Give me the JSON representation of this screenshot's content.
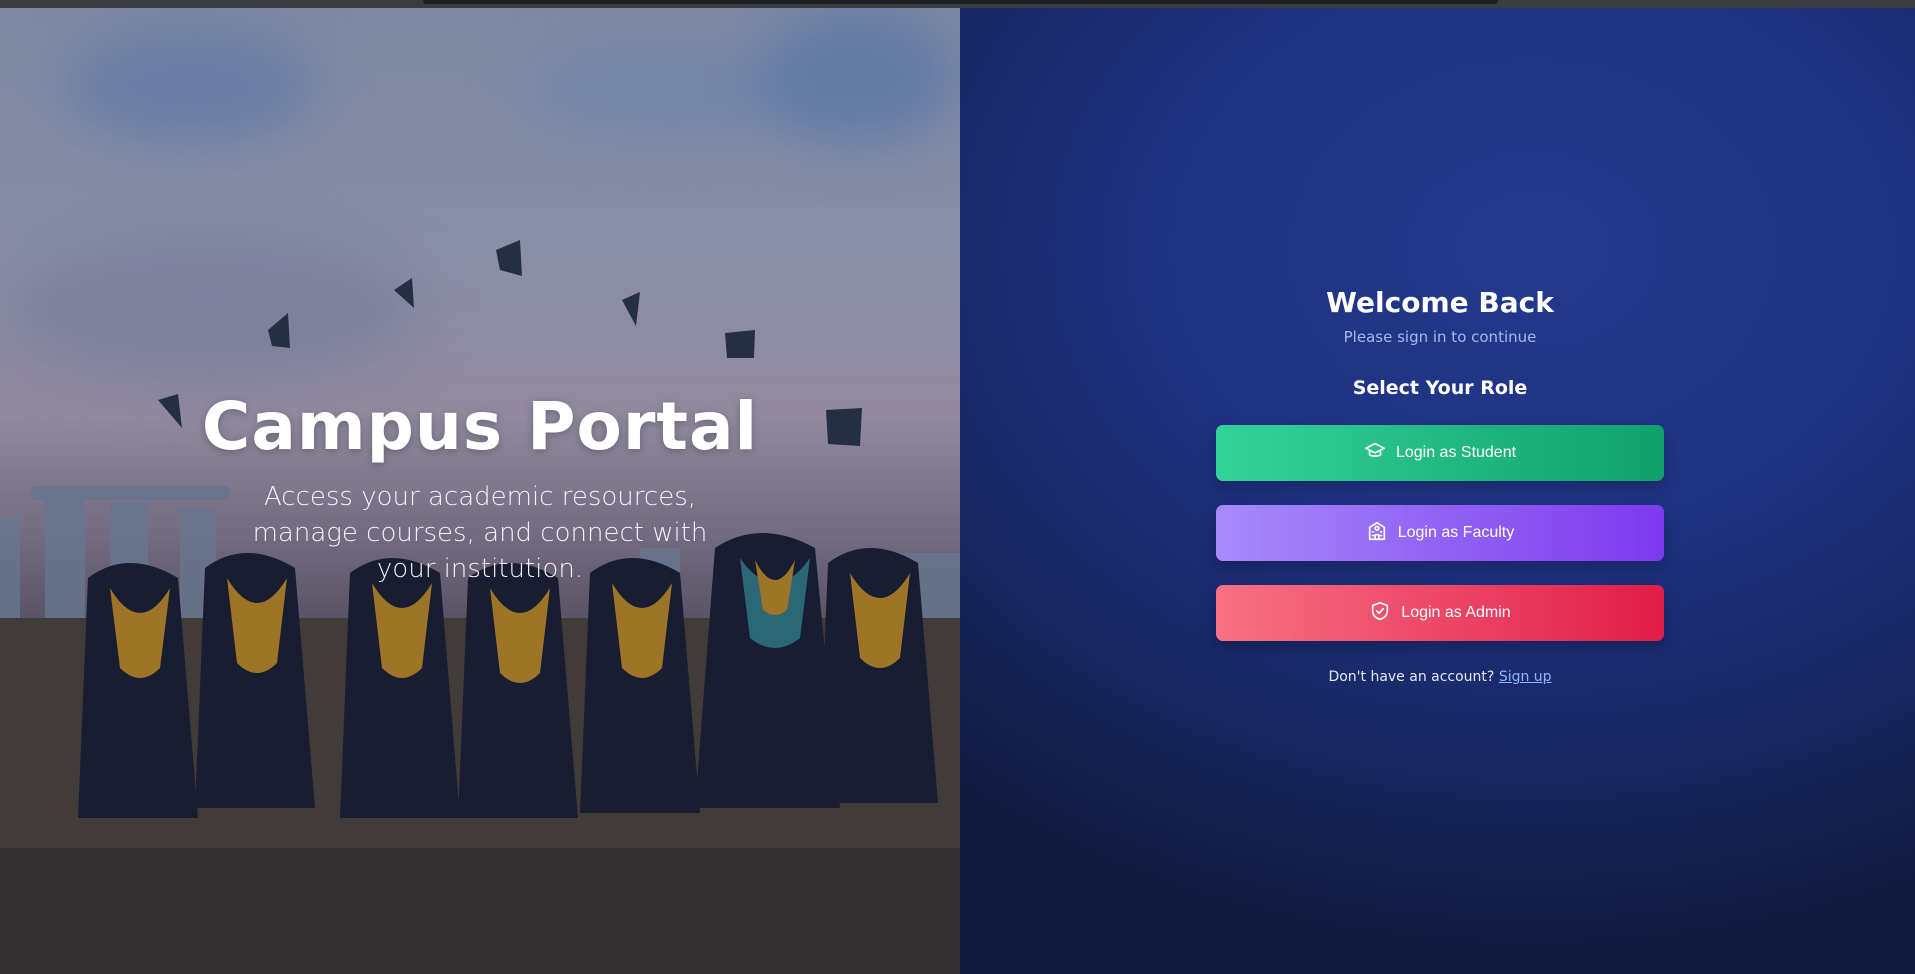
{
  "hero": {
    "title": "Campus Portal",
    "subtitle": "Access your academic resources, manage courses, and connect with your institution."
  },
  "login": {
    "heading": "Welcome Back",
    "subheading": "Please sign in to continue",
    "role_heading": "Select Your Role",
    "buttons": [
      {
        "label": "Login as Student",
        "icon": "graduation-cap-icon",
        "color": "#10a06c"
      },
      {
        "label": "Login as Faculty",
        "icon": "school-building-icon",
        "color": "#7c3aed"
      },
      {
        "label": "Login as Admin",
        "icon": "shield-check-icon",
        "color": "#e11d48"
      }
    ],
    "signup_prompt": "Don't have an account?",
    "signup_link": "Sign up"
  },
  "colors": {
    "panel_bg": "#1f3283",
    "link": "#93b4ff"
  }
}
